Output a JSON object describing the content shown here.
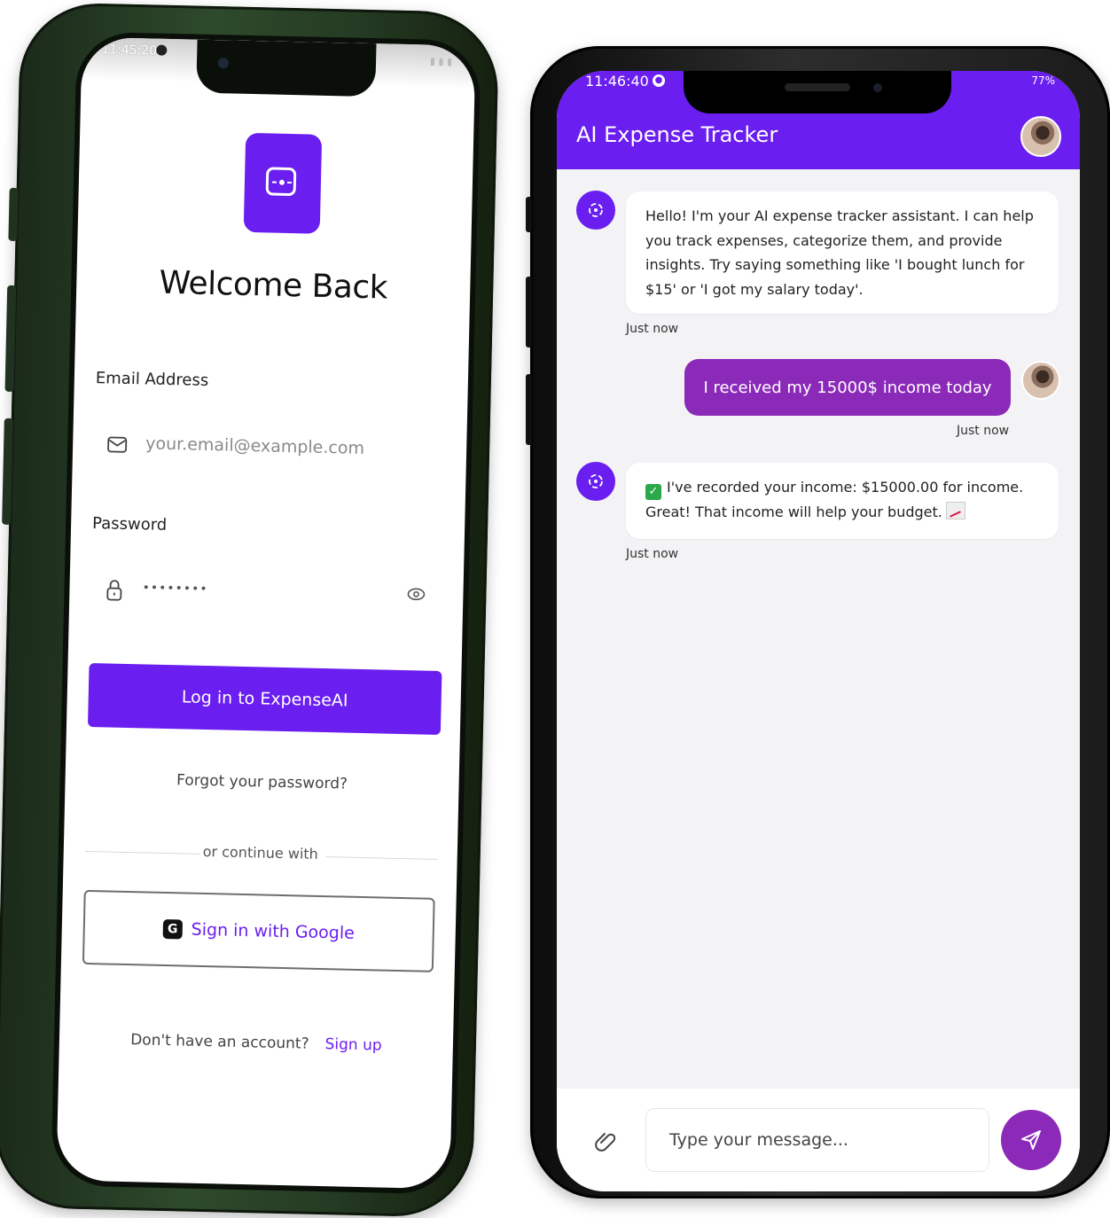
{
  "login": {
    "status_time": "11:45:20",
    "title": "Welcome Back",
    "email_label": "Email Address",
    "email_placeholder": "your.email@example.com",
    "password_label": "Password",
    "password_value": "••••••••",
    "login_button": "Log in to ExpenseAI",
    "forgot": "Forgot your password?",
    "or_continue": "or continue with",
    "google_button": "Sign in with Google",
    "no_account": "Don't have an account?",
    "signup": "Sign up"
  },
  "chat": {
    "status_time": "11:46:40",
    "status_battery": "77%",
    "title": "AI Expense Tracker",
    "messages": [
      {
        "sender": "bot",
        "text": "Hello! I'm your AI expense tracker assistant. I can help you track expenses, categorize them, and provide insights. Try saying something like 'I bought lunch for $15' or 'I got my salary today'.",
        "time": "Just now"
      },
      {
        "sender": "user",
        "text": "I received my 15000$ income today",
        "time": "Just now"
      },
      {
        "sender": "bot",
        "text": "I've recorded your income: $15000.00 for income. Great! That income will help your budget.",
        "time": "Just now"
      }
    ],
    "input_placeholder": "Type your message..."
  },
  "colors": {
    "primary": "#6a1ef0",
    "user_bubble": "#8b2ab8"
  },
  "icons": [
    "camera-logo-icon",
    "mail-icon",
    "lock-icon",
    "eye-icon",
    "google-icon",
    "bot-icon",
    "avatar",
    "attach-icon",
    "send-icon",
    "check-icon",
    "chart-icon"
  ]
}
